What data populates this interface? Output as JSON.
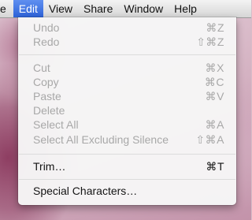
{
  "menubar": {
    "items": [
      "e",
      "Edit",
      "View",
      "Share",
      "Window",
      "Help"
    ]
  },
  "edit_menu": {
    "undo": {
      "label": "Undo",
      "shortcut": "⌘Z"
    },
    "redo": {
      "label": "Redo",
      "shortcut": "⇧⌘Z"
    },
    "cut": {
      "label": "Cut",
      "shortcut": "⌘X"
    },
    "copy": {
      "label": "Copy",
      "shortcut": "⌘C"
    },
    "paste": {
      "label": "Paste",
      "shortcut": "⌘V"
    },
    "delete": {
      "label": "Delete",
      "shortcut": ""
    },
    "select_all": {
      "label": "Select All",
      "shortcut": "⌘A"
    },
    "select_all_excluding_silence": {
      "label": "Select All Excluding Silence",
      "shortcut": "⇧⌘A"
    },
    "trim": {
      "label": "Trim…",
      "shortcut": "⌘T"
    },
    "special_characters": {
      "label": "Special Characters…",
      "shortcut": ""
    }
  }
}
